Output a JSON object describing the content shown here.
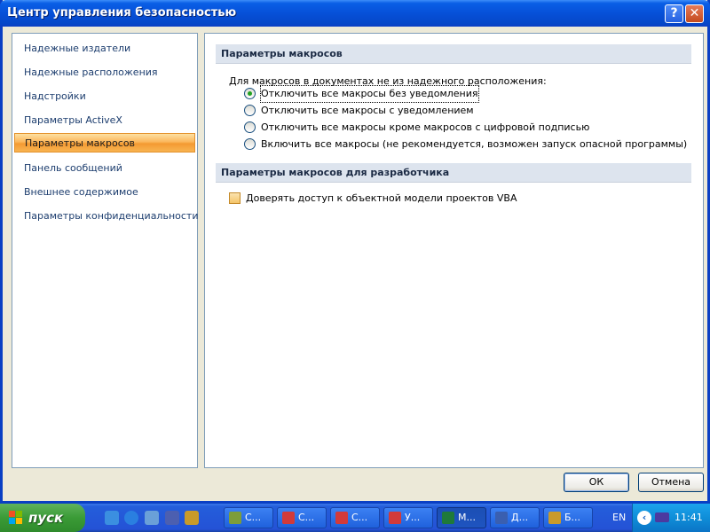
{
  "window": {
    "title": "Центр управления безопасностью",
    "help_glyph": "?",
    "close_glyph": "✕"
  },
  "nav": {
    "items": [
      {
        "label": "Надежные издатели"
      },
      {
        "label": "Надежные расположения"
      },
      {
        "label": "Надстройки"
      },
      {
        "label": "Параметры ActiveX"
      },
      {
        "label": "Параметры макросов",
        "active": true
      },
      {
        "label": "Панель сообщений"
      },
      {
        "label": "Внешнее содержимое"
      },
      {
        "label": "Параметры конфиденциальности"
      }
    ]
  },
  "macros": {
    "heading": "Параметры макросов",
    "intro": "Для макросов в документах не из надежного расположения:",
    "options": [
      {
        "label": "Отключить все макросы без уведомления",
        "checked": true
      },
      {
        "label": "Отключить все макросы с уведомлением",
        "checked": false
      },
      {
        "label": "Отключить все макросы кроме макросов с цифровой подписью",
        "checked": false
      },
      {
        "label": "Включить все макросы (не рекомендуется, возможен запуск опасной программы)",
        "checked": false
      }
    ]
  },
  "developer": {
    "heading": "Параметры макросов для разработчика",
    "vba_label": "Доверять доступ к объектной модели проектов VBA",
    "vba_checked": false
  },
  "buttons": {
    "ok": "ОК",
    "cancel": "Отмена"
  },
  "taskbar": {
    "start_label": "пуск",
    "tasks": [
      {
        "label": "C...",
        "icon_color": "#7d9d3a"
      },
      {
        "label": "C...",
        "icon_color": "#d23a3a"
      },
      {
        "label": "C...",
        "icon_color": "#d23a3a"
      },
      {
        "label": "У...",
        "icon_color": "#d23a3a"
      },
      {
        "label": "M...",
        "icon_color": "#1f7a3a",
        "active": true
      },
      {
        "label": "Д...",
        "icon_color": "#3a5fb0"
      },
      {
        "label": "Б...",
        "icon_color": "#c99a2a"
      }
    ],
    "language": "EN",
    "clock": "11:41"
  }
}
